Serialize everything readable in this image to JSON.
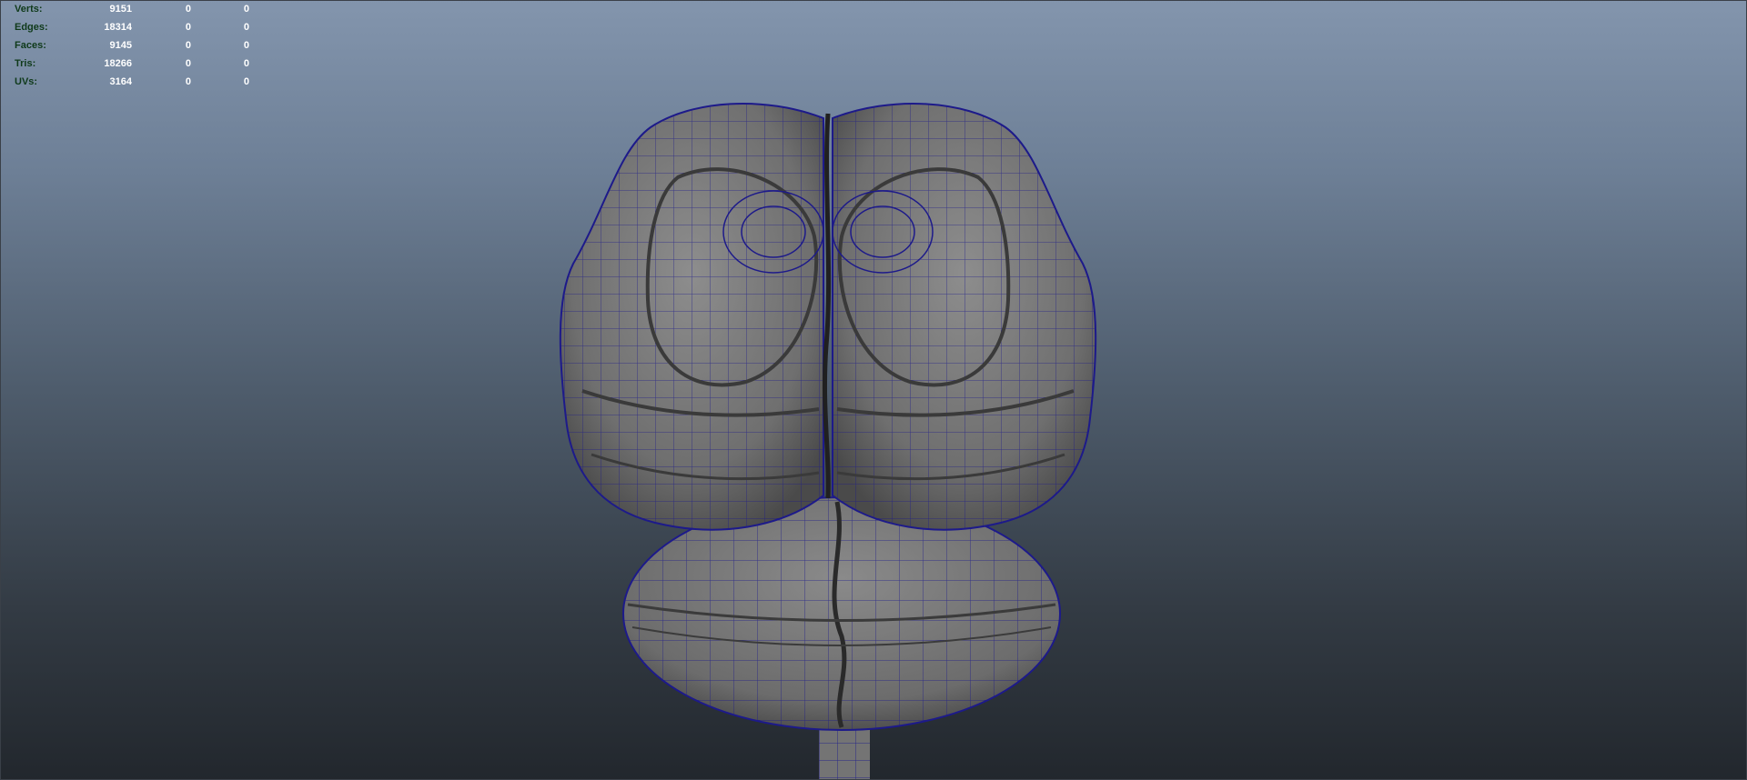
{
  "heads_up_display": {
    "stats": [
      {
        "label": "Verts:",
        "values": [
          "9151",
          "0",
          "0"
        ]
      },
      {
        "label": "Edges:",
        "values": [
          "18314",
          "0",
          "0"
        ]
      },
      {
        "label": "Faces:",
        "values": [
          "9145",
          "0",
          "0"
        ]
      },
      {
        "label": "Tris:",
        "values": [
          "18266",
          "0",
          "0"
        ]
      },
      {
        "label": "UVs:",
        "values": [
          "3164",
          "0",
          "0"
        ]
      }
    ]
  },
  "colors": {
    "background_top": "#8395ad",
    "background_bottom": "#22272d",
    "mesh_fill": "#7a7a7a",
    "wireframe": "#1a1a8c",
    "hud_label": "#0f3a1a",
    "hud_value": "#ffffff"
  },
  "viewport": {
    "object": "brain-mesh",
    "display": "smooth-shaded-with-wireframe"
  }
}
